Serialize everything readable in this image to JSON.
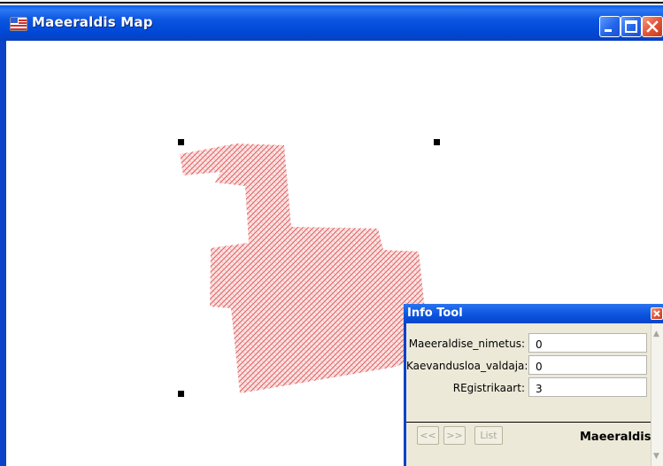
{
  "window": {
    "title": "Maeeraldis Map"
  },
  "title_buttons": {
    "minimize": "minimize",
    "maximize": "maximize",
    "close": "close"
  },
  "map": {
    "fill_color": "#e06060",
    "selection": "selected-feature-handles"
  },
  "info_tool": {
    "title": "Info Tool",
    "fields": [
      {
        "label": "Maeeraldise_nimetus:",
        "value": "0"
      },
      {
        "label": "Kaevandusloa_valdaja:",
        "value": "0"
      },
      {
        "label": "REgistrikaart:",
        "value": "3"
      }
    ],
    "nav": {
      "prev": "<<",
      "next": ">>",
      "list": "List"
    },
    "layer_name": "Maeeraldis"
  },
  "colors": {
    "titlebar": "#0a52de",
    "close_button": "#e2563a",
    "dialog_face": "#ece9d8"
  }
}
